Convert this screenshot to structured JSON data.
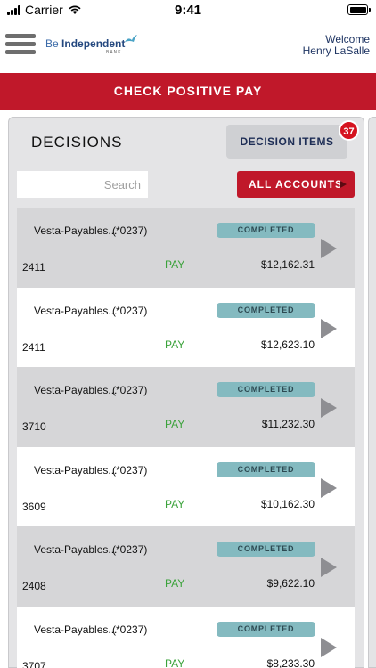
{
  "status_bar": {
    "carrier": "Carrier",
    "time": "9:41"
  },
  "header": {
    "logo": {
      "be": "Be",
      "independent": "Independent",
      "bank": "BANK"
    },
    "welcome_line1": "Welcome",
    "welcome_line2": "Henry LaSalle"
  },
  "banner": {
    "title": "CHECK POSITIVE PAY"
  },
  "decisions": {
    "title": "DECISIONS",
    "decision_items_label": "DECISION ITEMS",
    "decision_items_count": "37",
    "search_placeholder": "Search",
    "all_accounts_label": "ALL ACCOUNTS"
  },
  "items": [
    {
      "name": "Vesta-Payables...",
      "account": "(*0237)",
      "status": "COMPLETED",
      "check": "2411",
      "action": "PAY",
      "amount": "$12,162.31"
    },
    {
      "name": "Vesta-Payables...",
      "account": "(*0237)",
      "status": "COMPLETED",
      "check": "2411",
      "action": "PAY",
      "amount": "$12,623.10"
    },
    {
      "name": "Vesta-Payables...",
      "account": "(*0237)",
      "status": "COMPLETED",
      "check": "3710",
      "action": "PAY",
      "amount": "$11,232.30"
    },
    {
      "name": "Vesta-Payables...",
      "account": "(*0237)",
      "status": "COMPLETED",
      "check": "3609",
      "action": "PAY",
      "amount": "$10,162.30"
    },
    {
      "name": "Vesta-Payables...",
      "account": "(*0237)",
      "status": "COMPLETED",
      "check": "2408",
      "action": "PAY",
      "amount": "$9,622.10"
    },
    {
      "name": "Vesta-Payables...",
      "account": "(*0237)",
      "status": "COMPLETED",
      "check": "3707",
      "action": "PAY",
      "amount": "$8,233.30"
    }
  ],
  "colors": {
    "brand_red": "#c0182a",
    "status_pill": "#84bac0",
    "pay_green": "#3aa23a",
    "badge_red": "#d5131f"
  }
}
